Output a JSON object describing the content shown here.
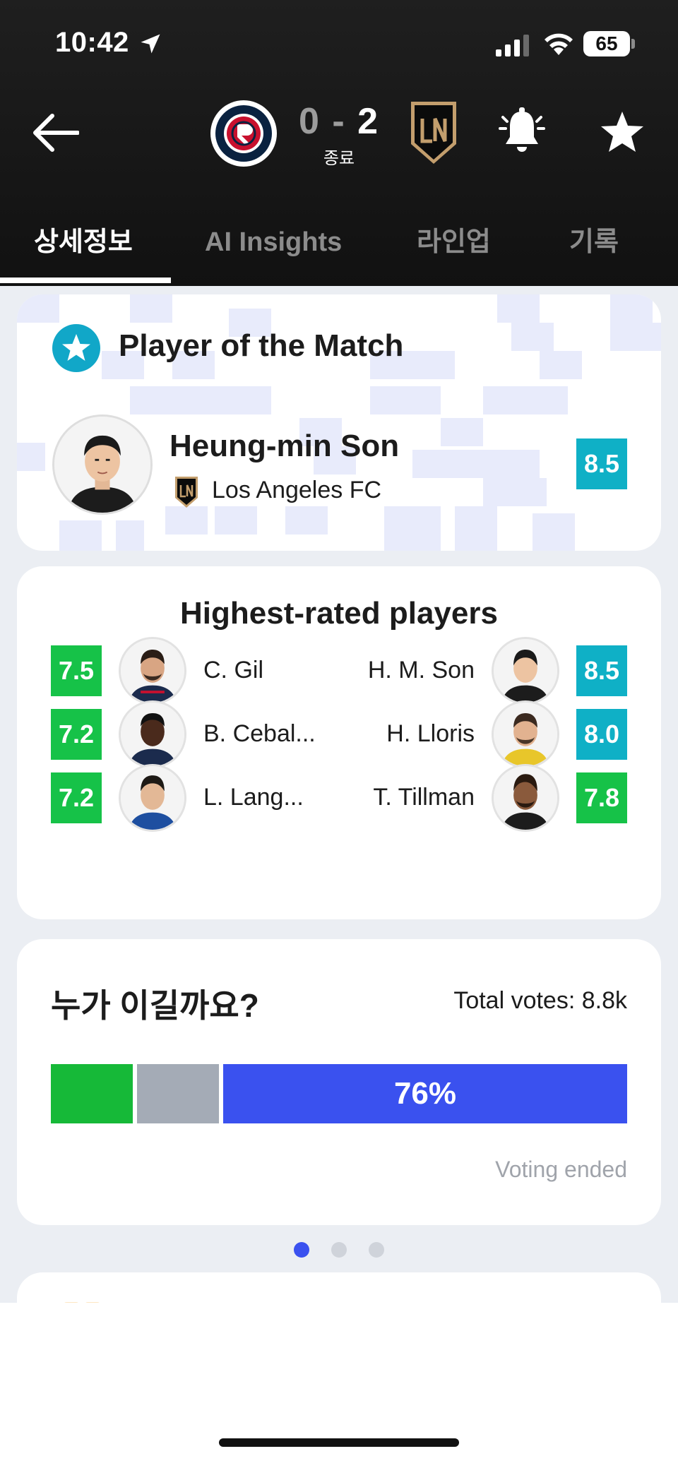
{
  "status_bar": {
    "time": "10:42",
    "battery": "65",
    "icons": [
      "location-arrow-icon",
      "signal-icon",
      "wifi-icon",
      "battery-icon"
    ]
  },
  "header": {
    "score_home": "0",
    "score_sep": "-",
    "score_away": "2",
    "match_status": "종료",
    "home_team_logo": "new-england-revolution-logo",
    "away_team_logo": "los-angeles-fc-logo",
    "colors": {
      "background": "#151515",
      "active": "#ffffff",
      "inactive": "#8c8c8c"
    }
  },
  "tabs": [
    {
      "label": "상세정보",
      "active": true
    },
    {
      "label": "AI Insights",
      "active": false
    },
    {
      "label": "라인업",
      "active": false
    },
    {
      "label": "기록",
      "active": false
    }
  ],
  "potm": {
    "title": "Player of the Match",
    "player_name": "Heung-min Son",
    "team": "Los Angeles FC",
    "rating": "8.5"
  },
  "highest_rated": {
    "title": "Highest-rated players",
    "rows": [
      {
        "left": {
          "rating": "7.5",
          "name": "C. Gil"
        },
        "right": {
          "name": "H. M. Son",
          "rating": "8.5"
        }
      },
      {
        "left": {
          "rating": "7.2",
          "name": "B. Cebal..."
        },
        "right": {
          "name": "H. Lloris",
          "rating": "8.0"
        }
      },
      {
        "left": {
          "rating": "7.2",
          "name": "L. Lang..."
        },
        "right": {
          "name": "T. Tillman",
          "rating": "7.8"
        }
      }
    ]
  },
  "vote": {
    "title": "누가 이길까요?",
    "total": "Total votes: 8.8k",
    "away_pct_label": "76%",
    "away_pct_value": 76,
    "status": "Voting ended",
    "colors": {
      "home": "#16b938",
      "draw": "#a4abb6",
      "away": "#3a51ef"
    }
  },
  "pagination": {
    "count": 3,
    "active_index": 0
  },
  "colors": {
    "rating_top": "#0fb0c6",
    "rating_good": "#16c248",
    "page_bg": "#ebeef3"
  }
}
